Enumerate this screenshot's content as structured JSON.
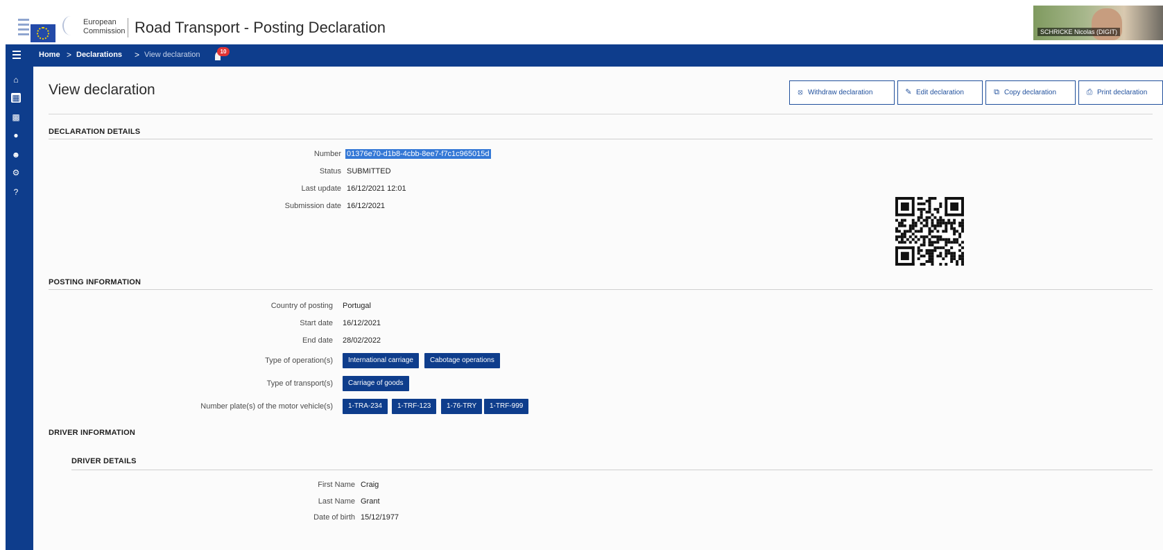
{
  "header": {
    "logo_line1": "European",
    "logo_line2": "Commission",
    "app_title": "Road Transport - Posting Declaration",
    "participant_name": "SCHRICKE Nicolas (DIGIT)"
  },
  "breadcrumb": {
    "items": [
      "Home",
      "Declarations",
      "View declaration"
    ],
    "separator": ">",
    "notification_count": "10"
  },
  "sidebar": {
    "icons": [
      "home-icon",
      "document-icon",
      "bus-icon",
      "chat-icon",
      "users-icon",
      "gear-icon",
      "help-icon"
    ]
  },
  "page": {
    "title": "View declaration",
    "actions": [
      "Withdraw declaration",
      "Edit declaration",
      "Copy declaration",
      "Print declaration"
    ]
  },
  "declaration_details": {
    "heading": "DECLARATION DETAILS",
    "number_label": "Number",
    "number": "01376e70-d1b8-4cbb-8ee7-f7c1c965015d",
    "status_label": "Status",
    "status": "SUBMITTED",
    "last_update_label": "Last update",
    "last_update": "16/12/2021 12:01",
    "submission_date_label": "Submission date",
    "submission_date": "16/12/2021"
  },
  "posting_information": {
    "heading": "POSTING INFORMATION",
    "country_label": "Country of posting",
    "country": "Portugal",
    "start_date_label": "Start date",
    "start_date": "16/12/2021",
    "end_date_label": "End date",
    "end_date": "28/02/2022",
    "operations_label": "Type of operation(s)",
    "operations": [
      "International carriage",
      "Cabotage operations"
    ],
    "transport_label": "Type of transport(s)",
    "transports": [
      "Carriage of goods"
    ],
    "plates_label": "Number plate(s) of the motor vehicle(s)",
    "plates": [
      "1-TRA-234",
      "1-TRF-123",
      "1-76-TRY",
      "1-TRF-999"
    ]
  },
  "driver_information": {
    "heading": "DRIVER INFORMATION",
    "subheading": "DRIVER DETAILS",
    "first_name_label": "First Name",
    "first_name": "Craig",
    "last_name_label": "Last Name",
    "last_name": "Grant",
    "dob_label": "Date of birth",
    "dob": "15/12/1977"
  },
  "colors": {
    "brand_blue": "#0e3d8c",
    "selection_blue": "#3478d6"
  }
}
